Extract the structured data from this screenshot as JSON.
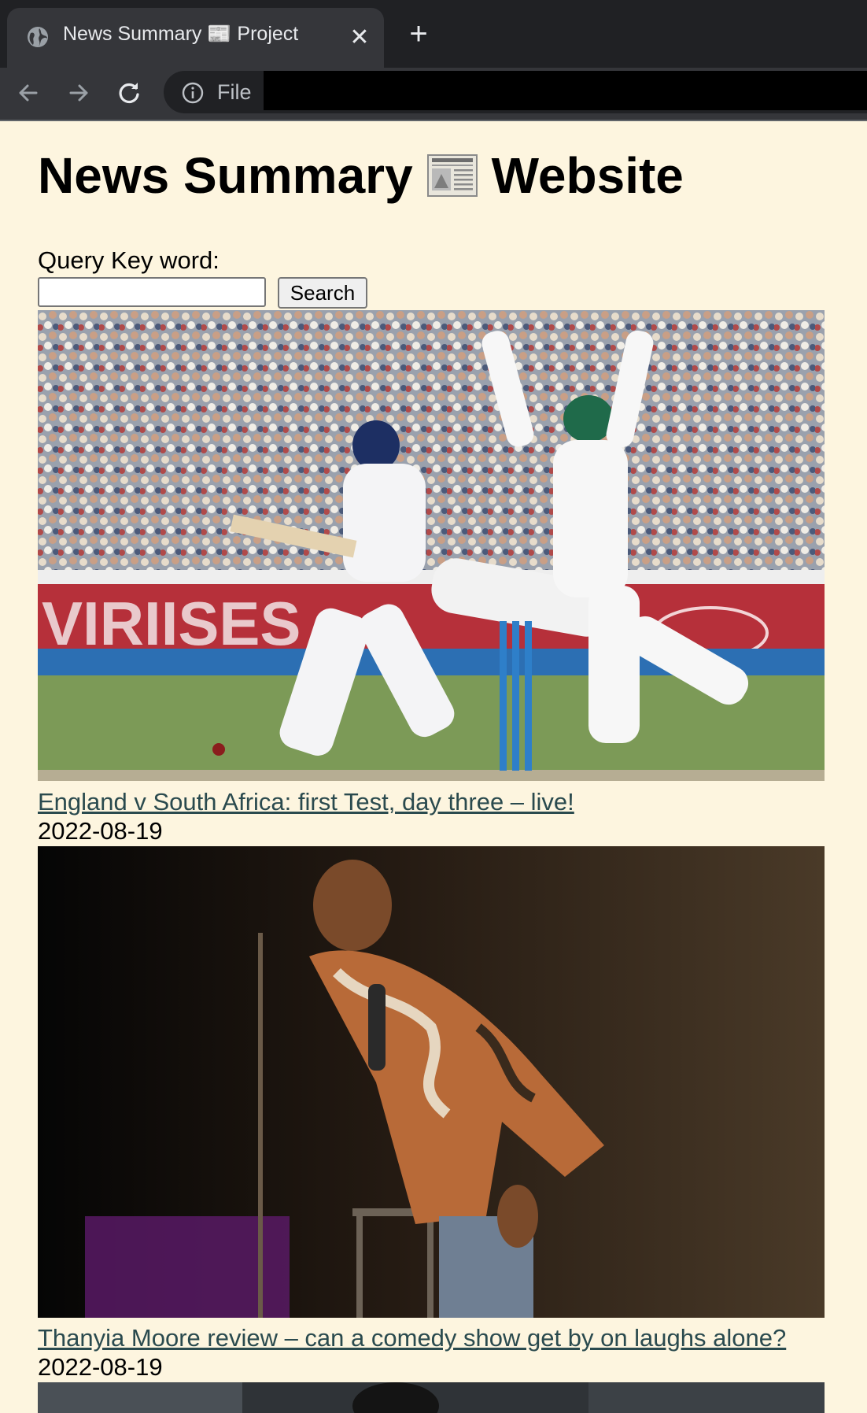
{
  "browser": {
    "tab_title": "News Summary 📰 Project",
    "tab_close_glyph": "✕",
    "new_tab_glyph": "+",
    "address_scheme_label": "File",
    "icons": [
      "globe-icon",
      "close-icon",
      "plus-icon",
      "back-arrow-icon",
      "forward-arrow-icon",
      "reload-icon",
      "info-icon"
    ]
  },
  "page": {
    "title_before": "News Summary",
    "title_after": "Website",
    "title_icon": "newspaper-icon",
    "query_label": "Query Key word:",
    "query_value": "",
    "search_button": "Search"
  },
  "articles": [
    {
      "image": "cricket-match-photo",
      "title": "England v South Africa: first Test, day three – live!",
      "date": "2022-08-19"
    },
    {
      "image": "comedian-on-stage-photo",
      "title": "Thanyia Moore review – can a comedy show get by on laughs alone?",
      "date": "2022-08-19"
    },
    {
      "image": "article-photo-partial"
    }
  ],
  "colors": {
    "page_background": "#fdf5df",
    "link": "#2a4a4e",
    "chrome_dark": "#202124",
    "chrome_tab": "#35363a"
  }
}
